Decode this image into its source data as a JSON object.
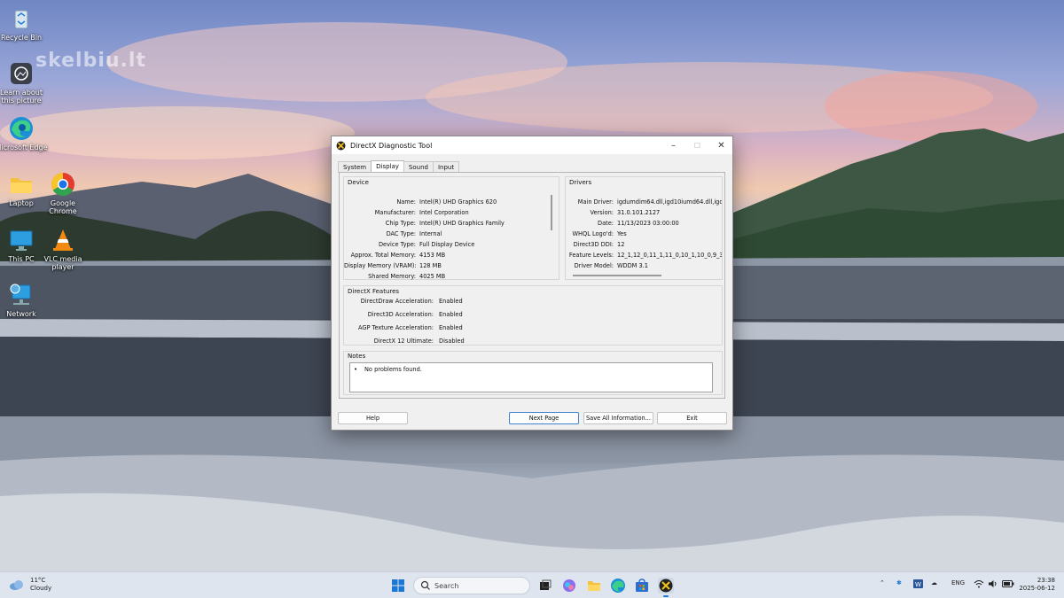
{
  "desktop": {
    "watermark": "skelbiu.lt",
    "icons": [
      {
        "label": "Recycle Bin"
      },
      {
        "label": "Learn about this picture"
      },
      {
        "label": "Microsoft Edge"
      },
      {
        "label": "Laptop"
      },
      {
        "label": "Google Chrome"
      },
      {
        "label": "This PC"
      },
      {
        "label": "VLC media player"
      },
      {
        "label": "Network"
      }
    ]
  },
  "dialog": {
    "title": "DirectX Diagnostic Tool",
    "tabs": [
      "System",
      "Display",
      "Sound",
      "Input"
    ],
    "active_tab": "Display",
    "device": {
      "title": "Device",
      "rows": [
        {
          "k": "Name:",
          "v": "Intel(R) UHD Graphics 620"
        },
        {
          "k": "Manufacturer:",
          "v": "Intel Corporation"
        },
        {
          "k": "Chip Type:",
          "v": "Intel(R) UHD Graphics Family"
        },
        {
          "k": "DAC Type:",
          "v": "Internal"
        },
        {
          "k": "Device Type:",
          "v": "Full Display Device"
        },
        {
          "k": "Approx. Total Memory:",
          "v": "4153 MB"
        },
        {
          "k": "Display Memory (VRAM):",
          "v": "128 MB"
        },
        {
          "k": "Shared Memory:",
          "v": "4025 MB"
        }
      ]
    },
    "drivers": {
      "title": "Drivers",
      "rows": [
        {
          "k": "Main Driver:",
          "v": "igdumdim64.dll,igd10iumd64.dll,igd10i"
        },
        {
          "k": "Version:",
          "v": "31.0.101.2127"
        },
        {
          "k": "Date:",
          "v": "11/13/2023 03:00:00"
        },
        {
          "k": "WHQL Logo'd:",
          "v": "Yes"
        },
        {
          "k": "Direct3D DDI:",
          "v": "12"
        },
        {
          "k": "Feature Levels:",
          "v": "12_1,12_0,11_1,11_0,10_1,10_0,9_3"
        },
        {
          "k": "Driver Model:",
          "v": "WDDM 3.1"
        }
      ]
    },
    "features": {
      "title": "DirectX Features",
      "rows": [
        {
          "k": "DirectDraw Acceleration:",
          "v": "Enabled"
        },
        {
          "k": "Direct3D Acceleration:",
          "v": "Enabled"
        },
        {
          "k": "AGP Texture Acceleration:",
          "v": "Enabled"
        },
        {
          "k": "DirectX 12 Ultimate:",
          "v": "Disabled"
        }
      ]
    },
    "notes": {
      "title": "Notes",
      "bullet": "•",
      "text": "No problems found."
    },
    "buttons": {
      "help": "Help",
      "next": "Next Page",
      "save": "Save All Information...",
      "exit": "Exit"
    }
  },
  "taskbar": {
    "weather_temp": "11°C",
    "weather_cond": "Cloudy",
    "search_placeholder": "Search",
    "lang": "ENG",
    "time": "23:38",
    "date": "2025-06-12"
  }
}
